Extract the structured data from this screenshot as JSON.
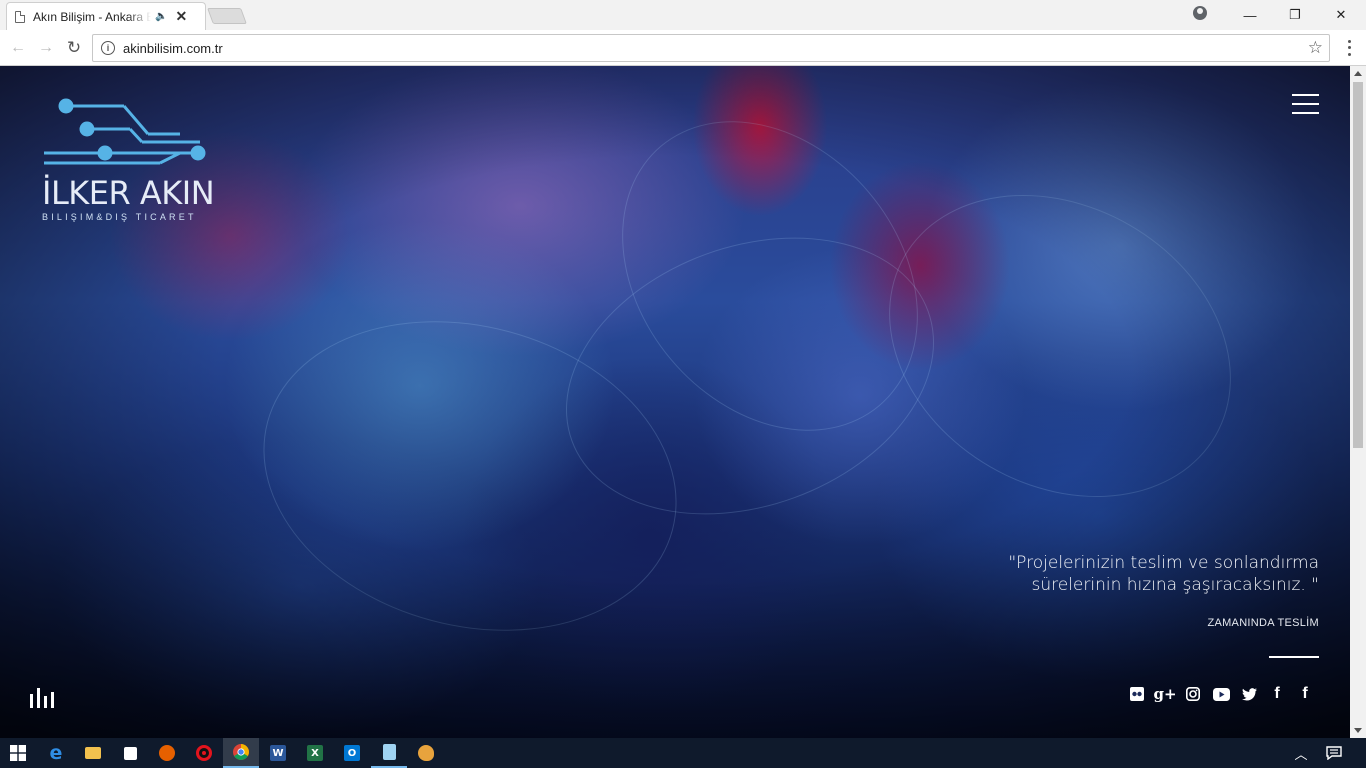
{
  "browser": {
    "tab_title": "Akın Bilişim - Ankara Bilişim",
    "tab_audio": "🔈",
    "tab_close": "✕",
    "url": "akinbilisim.com.tr",
    "window_controls": {
      "minimize": "—",
      "restore": "❐",
      "close": "✕"
    }
  },
  "site": {
    "logo": {
      "name": "İLKER AKIN",
      "subtitle": "BILIŞIM&DIŞ TICARET"
    },
    "quote_line1": "\"Projelerinizin teslim ve sonlandırma",
    "quote_line2": "sürelerinin hızına şaşıracaksınız. \"",
    "caption": "ZAMANINDA TESLİM",
    "social": [
      {
        "icon": "flickr-icon"
      },
      {
        "icon": "google-plus-icon",
        "text": "g+"
      },
      {
        "icon": "instagram-icon"
      },
      {
        "icon": "youtube-icon"
      },
      {
        "icon": "twitter-icon"
      },
      {
        "icon": "facebook-icon",
        "text": "f"
      },
      {
        "icon": "facebook-icon",
        "text": "f"
      }
    ]
  },
  "taskbar": {
    "apps": [
      {
        "name": "start-icon"
      },
      {
        "name": "edge-icon",
        "text": "e",
        "color": "#1e73d1"
      },
      {
        "name": "file-explorer-icon",
        "color": "#f2c14e"
      },
      {
        "name": "store-icon",
        "color": "#ffffff"
      },
      {
        "name": "firefox-icon",
        "color": "#e66000"
      },
      {
        "name": "opera-icon",
        "text": "O",
        "color": "#e2141e"
      },
      {
        "name": "chrome-icon",
        "color": "#4285f4"
      },
      {
        "name": "word-icon",
        "text": "W",
        "color": "#2b579a"
      },
      {
        "name": "excel-icon",
        "text": "X",
        "color": "#217346"
      },
      {
        "name": "outlook-icon",
        "text": "O",
        "color": "#0078d4"
      },
      {
        "name": "notepad-icon",
        "color": "#9fd3f2"
      },
      {
        "name": "paint-icon",
        "color": "#e8a33d"
      }
    ]
  }
}
